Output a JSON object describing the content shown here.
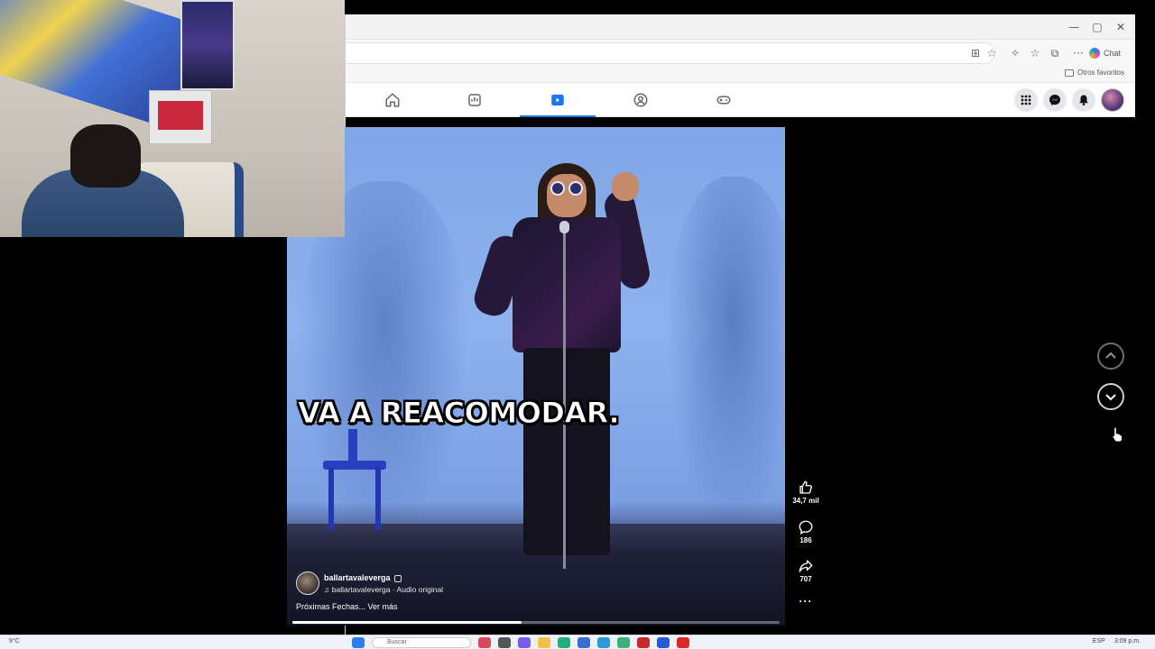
{
  "browser": {
    "window_controls": {
      "minimize": "—",
      "restore": "▢",
      "close": "✕"
    },
    "toolbar": {
      "copilot_label": "Chat",
      "more": "···"
    },
    "favorites": {
      "other_favorites": "Otros favoritos"
    }
  },
  "facebook_nav": {
    "tabs": [
      {
        "name": "home",
        "icon": "home-icon"
      },
      {
        "name": "marketplace",
        "icon": "store-icon"
      },
      {
        "name": "reels",
        "icon": "video-icon",
        "active": true
      },
      {
        "name": "groups",
        "icon": "groups-icon"
      },
      {
        "name": "gaming",
        "icon": "gamepad-icon"
      }
    ],
    "accent_color": "#1877f2"
  },
  "reel": {
    "caption_text": "VA A REACOMODAR.",
    "channel_name": "ballartavaleverga",
    "audio_label": "♫ ballartavaleverga · Audio original",
    "description": "Próximas Fechas... Ver más",
    "progress": 0.47
  },
  "actions": {
    "likes": "34,7 mil",
    "comments": "186",
    "shares": "707",
    "more": "···"
  },
  "taskbar": {
    "weather": "9°C",
    "search_placeholder": "Buscar",
    "lang": "ESP",
    "time": "3:09 p.m."
  }
}
